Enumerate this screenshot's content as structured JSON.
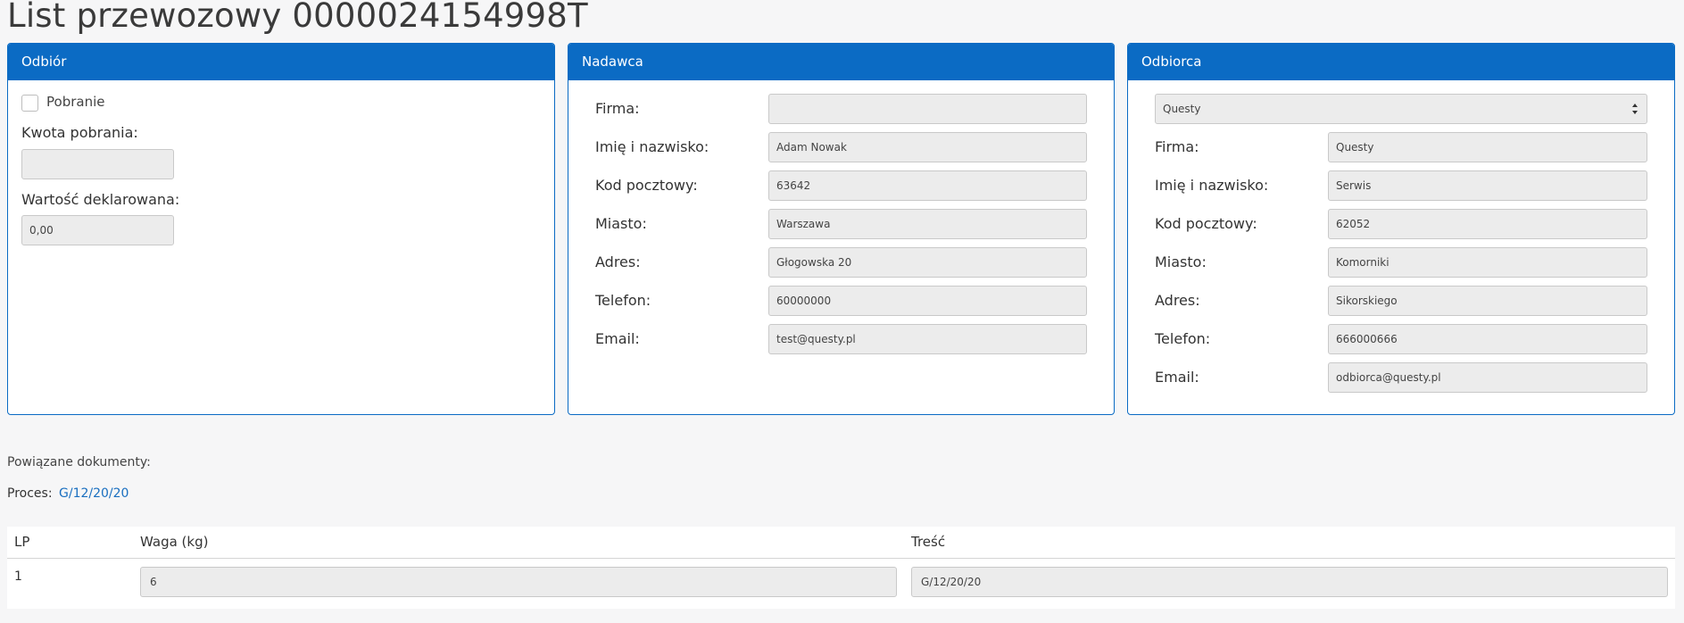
{
  "page": {
    "title": "List przewozowy 0000024154998T"
  },
  "odbior": {
    "header": "Odbiór",
    "cod_label": "Pobranie",
    "cod_checked": false,
    "cod_amount_label": "Kwota pobrania:",
    "cod_amount_value": "",
    "declared_value_label": "Wartość deklarowana:",
    "declared_value": "0,00"
  },
  "nadawca": {
    "header": "Nadawca",
    "fields": [
      {
        "label": "Firma:",
        "value": ""
      },
      {
        "label": "Imię i nazwisko:",
        "value": "Adam Nowak"
      },
      {
        "label": "Kod pocztowy:",
        "value": "63642"
      },
      {
        "label": "Miasto:",
        "value": "Warszawa"
      },
      {
        "label": "Adres:",
        "value": "Głogowska 20"
      },
      {
        "label": "Telefon:",
        "value": "60000000"
      },
      {
        "label": "Email:",
        "value": "test@questy.pl"
      }
    ]
  },
  "odbiorca": {
    "header": "Odbiorca",
    "select_value": "Questy",
    "fields": [
      {
        "label": "Firma:",
        "value": "Questy"
      },
      {
        "label": "Imię i nazwisko:",
        "value": "Serwis"
      },
      {
        "label": "Kod pocztowy:",
        "value": "62052"
      },
      {
        "label": "Miasto:",
        "value": "Komorniki"
      },
      {
        "label": "Adres:",
        "value": "Sikorskiego"
      },
      {
        "label": "Telefon:",
        "value": "666000666"
      },
      {
        "label": "Email:",
        "value": "odbiorca@questy.pl"
      }
    ]
  },
  "related": {
    "label": "Powiązane dokumenty:",
    "proces_label": "Proces:",
    "proces_link": "G/12/20/20"
  },
  "packages": {
    "headers": [
      "LP",
      "Waga (kg)",
      "Treść"
    ],
    "rows": [
      {
        "lp": "1",
        "weight": "6",
        "content": "G/12/20/20"
      }
    ]
  },
  "colors": {
    "accent": "#0b6bc4",
    "link": "#1a6fc0"
  }
}
